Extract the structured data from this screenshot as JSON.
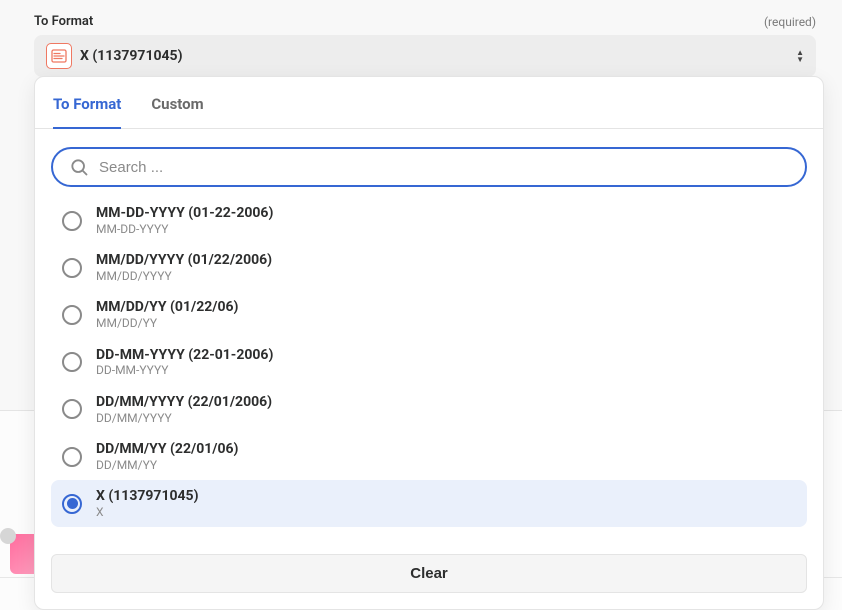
{
  "field": {
    "label": "To Format",
    "required_text": "(required)",
    "selected_value": "X (1137971045)"
  },
  "dropdown": {
    "tabs": [
      {
        "label": "To Format",
        "active": true
      },
      {
        "label": "Custom",
        "active": false
      }
    ],
    "search_placeholder": "Search ...",
    "clear_label": "Clear",
    "options": [
      {
        "label": "MM-DD-YYYY (01-22-2006)",
        "sub": "MM-DD-YYYY",
        "selected": false
      },
      {
        "label": "MM/DD/YYYY (01/22/2006)",
        "sub": "MM/DD/YYYY",
        "selected": false
      },
      {
        "label": "MM/DD/YY (01/22/06)",
        "sub": "MM/DD/YY",
        "selected": false
      },
      {
        "label": "DD-MM-YYYY (22-01-2006)",
        "sub": "DD-MM-YYYY",
        "selected": false
      },
      {
        "label": "DD/MM/YYYY (22/01/2006)",
        "sub": "DD/MM/YYYY",
        "selected": false
      },
      {
        "label": "DD/MM/YY (22/01/06)",
        "sub": "DD/MM/YY",
        "selected": false
      },
      {
        "label": "X (1137971045)",
        "sub": "X",
        "selected": true
      }
    ]
  }
}
